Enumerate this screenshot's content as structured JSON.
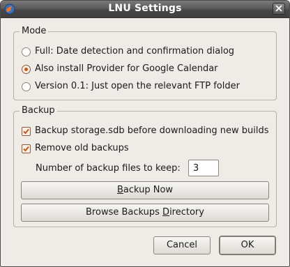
{
  "window": {
    "title": "LNU Settings",
    "colors": {
      "background": "#efebe7",
      "titlebar": "#4a4a4a",
      "accent": "#c05a1a"
    }
  },
  "mode": {
    "legend": "Mode",
    "options": [
      {
        "label": "Full: Date detection and confirmation dialog",
        "selected": false
      },
      {
        "label": "Also install Provider for Google Calendar",
        "selected": true
      },
      {
        "label": "Version 0.1: Just open the relevant FTP folder",
        "selected": false
      }
    ]
  },
  "backup": {
    "legend": "Backup",
    "checkboxes": [
      {
        "label": "Backup storage.sdb before downloading new builds",
        "checked": true
      },
      {
        "label": "Remove old backups",
        "checked": true
      }
    ],
    "keep_label": "Number of backup files to keep:",
    "keep_value": "3",
    "backup_now": {
      "mnemonic": "B",
      "rest": "ackup Now"
    },
    "browse": {
      "before": "Browse Backups ",
      "mnemonic": "D",
      "after": "irectory"
    }
  },
  "buttons": {
    "cancel": "Cancel",
    "ok": "OK"
  }
}
